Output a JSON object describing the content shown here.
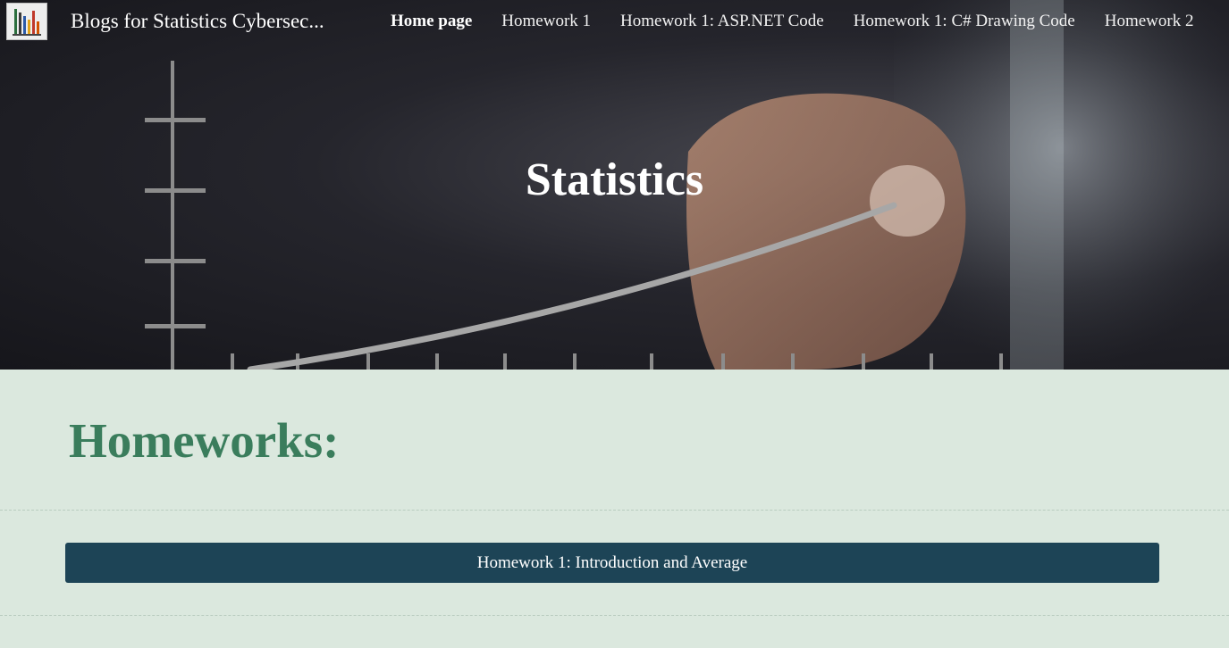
{
  "header": {
    "site_title": "Blogs for Statistics Cybersec...",
    "logo": "bar-chart-logo"
  },
  "nav": {
    "items": [
      {
        "label": "Home page",
        "active": true
      },
      {
        "label": "Homework 1",
        "active": false
      },
      {
        "label": "Homework 1: ASP.NET Code",
        "active": false
      },
      {
        "label": "Homework 1: C# Drawing Code",
        "active": false
      },
      {
        "label": "Homework 2",
        "active": false
      }
    ]
  },
  "hero": {
    "title": "Statistics"
  },
  "main": {
    "heading": "Homeworks:",
    "buttons": [
      {
        "label": "Homework 1: Introduction and Average"
      }
    ]
  },
  "colors": {
    "heading": "#3a7d5c",
    "button_bg": "#1d4456",
    "page_bg": "#dbe8de"
  }
}
